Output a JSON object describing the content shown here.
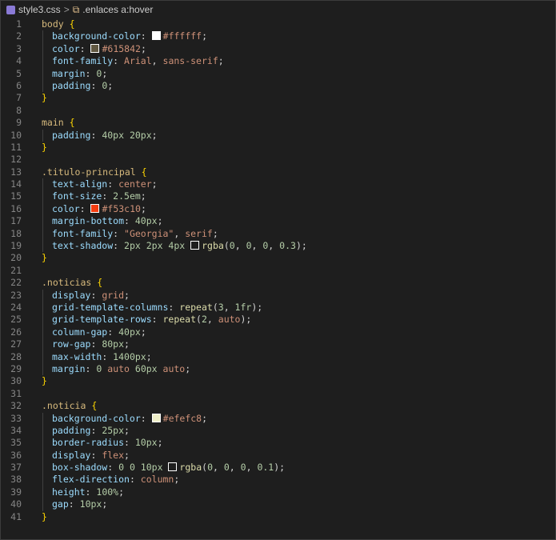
{
  "breadcrumb": {
    "file": "style3.css",
    "separator": ">",
    "selector": ".enlaces a:hover"
  },
  "colors": {
    "white": "#ffffff",
    "brown": "#615842",
    "red": "#f53c10",
    "beige": "#efefc8",
    "transparent": "transparent"
  },
  "lines": [
    {
      "n": "1",
      "indent": 1,
      "tokens": [
        [
          "sel",
          "body "
        ],
        [
          "brace",
          "{"
        ]
      ]
    },
    {
      "n": "2",
      "indent": 2,
      "tokens": [
        [
          "prop",
          "background-color"
        ],
        [
          "punc",
          ": "
        ],
        [
          "swatch",
          "#ffffff"
        ],
        [
          "val",
          "#ffffff"
        ],
        [
          "punc",
          ";"
        ]
      ]
    },
    {
      "n": "3",
      "indent": 2,
      "tokens": [
        [
          "prop",
          "color"
        ],
        [
          "punc",
          ": "
        ],
        [
          "swatch",
          "#615842"
        ],
        [
          "val",
          "#615842"
        ],
        [
          "punc",
          ";"
        ]
      ]
    },
    {
      "n": "4",
      "indent": 2,
      "tokens": [
        [
          "prop",
          "font-family"
        ],
        [
          "punc",
          ": "
        ],
        [
          "val",
          "Arial"
        ],
        [
          "punc",
          ", "
        ],
        [
          "val",
          "sans-serif"
        ],
        [
          "punc",
          ";"
        ]
      ]
    },
    {
      "n": "5",
      "indent": 2,
      "tokens": [
        [
          "prop",
          "margin"
        ],
        [
          "punc",
          ": "
        ],
        [
          "num",
          "0"
        ],
        [
          "punc",
          ";"
        ]
      ]
    },
    {
      "n": "6",
      "indent": 2,
      "tokens": [
        [
          "prop",
          "padding"
        ],
        [
          "punc",
          ": "
        ],
        [
          "num",
          "0"
        ],
        [
          "punc",
          ";"
        ]
      ]
    },
    {
      "n": "7",
      "indent": 1,
      "tokens": [
        [
          "brace",
          "}"
        ]
      ]
    },
    {
      "n": "8",
      "indent": 0,
      "tokens": []
    },
    {
      "n": "9",
      "indent": 1,
      "tokens": [
        [
          "sel",
          "main "
        ],
        [
          "brace",
          "{"
        ]
      ]
    },
    {
      "n": "10",
      "indent": 2,
      "tokens": [
        [
          "prop",
          "padding"
        ],
        [
          "punc",
          ": "
        ],
        [
          "num",
          "40px 20px"
        ],
        [
          "punc",
          ";"
        ]
      ]
    },
    {
      "n": "11",
      "indent": 1,
      "tokens": [
        [
          "brace",
          "}"
        ]
      ]
    },
    {
      "n": "12",
      "indent": 0,
      "tokens": []
    },
    {
      "n": "13",
      "indent": 1,
      "tokens": [
        [
          "sel",
          ".titulo-principal "
        ],
        [
          "brace",
          "{"
        ]
      ]
    },
    {
      "n": "14",
      "indent": 2,
      "tokens": [
        [
          "prop",
          "text-align"
        ],
        [
          "punc",
          ": "
        ],
        [
          "val",
          "center"
        ],
        [
          "punc",
          ";"
        ]
      ]
    },
    {
      "n": "15",
      "indent": 2,
      "tokens": [
        [
          "prop",
          "font-size"
        ],
        [
          "punc",
          ": "
        ],
        [
          "num",
          "2.5em"
        ],
        [
          "punc",
          ";"
        ]
      ]
    },
    {
      "n": "16",
      "indent": 2,
      "tokens": [
        [
          "prop",
          "color"
        ],
        [
          "punc",
          ": "
        ],
        [
          "swatch",
          "#f53c10"
        ],
        [
          "val",
          "#f53c10"
        ],
        [
          "punc",
          ";"
        ]
      ]
    },
    {
      "n": "17",
      "indent": 2,
      "tokens": [
        [
          "prop",
          "margin-bottom"
        ],
        [
          "punc",
          ": "
        ],
        [
          "num",
          "40px"
        ],
        [
          "punc",
          ";"
        ]
      ]
    },
    {
      "n": "18",
      "indent": 2,
      "tokens": [
        [
          "prop",
          "font-family"
        ],
        [
          "punc",
          ": "
        ],
        [
          "val",
          "\"Georgia\""
        ],
        [
          "punc",
          ", "
        ],
        [
          "val",
          "serif"
        ],
        [
          "punc",
          ";"
        ]
      ]
    },
    {
      "n": "19",
      "indent": 2,
      "tokens": [
        [
          "prop",
          "text-shadow"
        ],
        [
          "punc",
          ": "
        ],
        [
          "num",
          "2px 2px 4px "
        ],
        [
          "swatch",
          "transparent"
        ],
        [
          "fn",
          "rgba"
        ],
        [
          "punc",
          "("
        ],
        [
          "num",
          "0"
        ],
        [
          "punc",
          ", "
        ],
        [
          "num",
          "0"
        ],
        [
          "punc",
          ", "
        ],
        [
          "num",
          "0"
        ],
        [
          "punc",
          ", "
        ],
        [
          "num",
          "0.3"
        ],
        [
          "punc",
          ");"
        ]
      ]
    },
    {
      "n": "20",
      "indent": 1,
      "tokens": [
        [
          "brace",
          "}"
        ]
      ]
    },
    {
      "n": "21",
      "indent": 0,
      "tokens": []
    },
    {
      "n": "22",
      "indent": 1,
      "tokens": [
        [
          "sel",
          ".noticias "
        ],
        [
          "brace",
          "{"
        ]
      ]
    },
    {
      "n": "23",
      "indent": 2,
      "tokens": [
        [
          "prop",
          "display"
        ],
        [
          "punc",
          ": "
        ],
        [
          "val",
          "grid"
        ],
        [
          "punc",
          ";"
        ]
      ]
    },
    {
      "n": "24",
      "indent": 2,
      "tokens": [
        [
          "prop",
          "grid-template-columns"
        ],
        [
          "punc",
          ": "
        ],
        [
          "fn",
          "repeat"
        ],
        [
          "punc",
          "("
        ],
        [
          "num",
          "3"
        ],
        [
          "punc",
          ", "
        ],
        [
          "num",
          "1fr"
        ],
        [
          "punc",
          ");"
        ]
      ]
    },
    {
      "n": "25",
      "indent": 2,
      "tokens": [
        [
          "prop",
          "grid-template-rows"
        ],
        [
          "punc",
          ": "
        ],
        [
          "fn",
          "repeat"
        ],
        [
          "punc",
          "("
        ],
        [
          "num",
          "2"
        ],
        [
          "punc",
          ", "
        ],
        [
          "val",
          "auto"
        ],
        [
          "punc",
          ");"
        ]
      ]
    },
    {
      "n": "26",
      "indent": 2,
      "tokens": [
        [
          "prop",
          "column-gap"
        ],
        [
          "punc",
          ": "
        ],
        [
          "num",
          "40px"
        ],
        [
          "punc",
          ";"
        ]
      ]
    },
    {
      "n": "27",
      "indent": 2,
      "tokens": [
        [
          "prop",
          "row-gap"
        ],
        [
          "punc",
          ": "
        ],
        [
          "num",
          "80px"
        ],
        [
          "punc",
          ";"
        ]
      ]
    },
    {
      "n": "28",
      "indent": 2,
      "tokens": [
        [
          "prop",
          "max-width"
        ],
        [
          "punc",
          ": "
        ],
        [
          "num",
          "1400px"
        ],
        [
          "punc",
          ";"
        ]
      ]
    },
    {
      "n": "29",
      "indent": 2,
      "tokens": [
        [
          "prop",
          "margin"
        ],
        [
          "punc",
          ": "
        ],
        [
          "num",
          "0 "
        ],
        [
          "val",
          "auto "
        ],
        [
          "num",
          "60px "
        ],
        [
          "val",
          "auto"
        ],
        [
          "punc",
          ";"
        ]
      ]
    },
    {
      "n": "30",
      "indent": 1,
      "tokens": [
        [
          "brace",
          "}"
        ]
      ]
    },
    {
      "n": "31",
      "indent": 0,
      "tokens": []
    },
    {
      "n": "32",
      "indent": 1,
      "tokens": [
        [
          "sel",
          ".noticia "
        ],
        [
          "brace",
          "{"
        ]
      ]
    },
    {
      "n": "33",
      "indent": 2,
      "tokens": [
        [
          "prop",
          "background-color"
        ],
        [
          "punc",
          ": "
        ],
        [
          "swatch",
          "#efefc8"
        ],
        [
          "val",
          "#efefc8"
        ],
        [
          "punc",
          ";"
        ]
      ]
    },
    {
      "n": "34",
      "indent": 2,
      "tokens": [
        [
          "prop",
          "padding"
        ],
        [
          "punc",
          ": "
        ],
        [
          "num",
          "25px"
        ],
        [
          "punc",
          ";"
        ]
      ]
    },
    {
      "n": "35",
      "indent": 2,
      "tokens": [
        [
          "prop",
          "border-radius"
        ],
        [
          "punc",
          ": "
        ],
        [
          "num",
          "10px"
        ],
        [
          "punc",
          ";"
        ]
      ]
    },
    {
      "n": "36",
      "indent": 2,
      "tokens": [
        [
          "prop",
          "display"
        ],
        [
          "punc",
          ": "
        ],
        [
          "val",
          "flex"
        ],
        [
          "punc",
          ";"
        ]
      ]
    },
    {
      "n": "37",
      "indent": 2,
      "tokens": [
        [
          "prop",
          "box-shadow"
        ],
        [
          "punc",
          ": "
        ],
        [
          "num",
          "0 0 10px "
        ],
        [
          "swatch",
          "transparent"
        ],
        [
          "fn",
          "rgba"
        ],
        [
          "punc",
          "("
        ],
        [
          "num",
          "0"
        ],
        [
          "punc",
          ", "
        ],
        [
          "num",
          "0"
        ],
        [
          "punc",
          ", "
        ],
        [
          "num",
          "0"
        ],
        [
          "punc",
          ", "
        ],
        [
          "num",
          "0.1"
        ],
        [
          "punc",
          ");"
        ]
      ]
    },
    {
      "n": "38",
      "indent": 2,
      "tokens": [
        [
          "prop",
          "flex-direction"
        ],
        [
          "punc",
          ": "
        ],
        [
          "val",
          "column"
        ],
        [
          "punc",
          ";"
        ]
      ]
    },
    {
      "n": "39",
      "indent": 2,
      "tokens": [
        [
          "prop",
          "height"
        ],
        [
          "punc",
          ": "
        ],
        [
          "num",
          "100%"
        ],
        [
          "punc",
          ";"
        ]
      ]
    },
    {
      "n": "40",
      "indent": 2,
      "tokens": [
        [
          "prop",
          "gap"
        ],
        [
          "punc",
          ": "
        ],
        [
          "num",
          "10px"
        ],
        [
          "punc",
          ";"
        ]
      ]
    },
    {
      "n": "41",
      "indent": 1,
      "tokens": [
        [
          "brace",
          "}"
        ]
      ]
    }
  ]
}
